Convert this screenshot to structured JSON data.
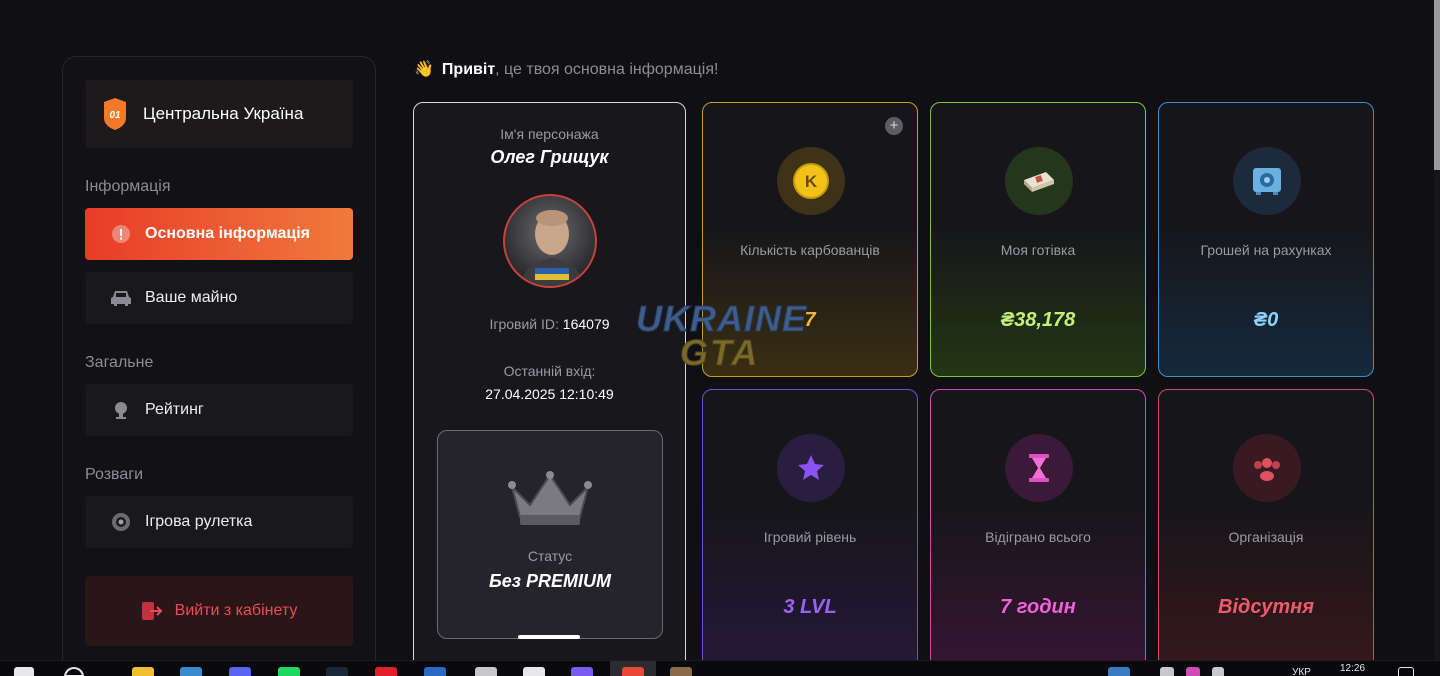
{
  "sidebar": {
    "server_badge": "01",
    "server_name": "Центральна Україна",
    "sections": {
      "info": "Інформація",
      "general": "Загальне",
      "fun": "Розваги"
    },
    "items": {
      "main_info": "Основна інформація",
      "property": "Ваше майно",
      "rating": "Рейтинг",
      "roulette": "Ігрова рулетка",
      "logout": "Вийти з кабінету"
    }
  },
  "greeting": {
    "wave": "👋",
    "hello": "Привіт",
    "rest": ", це твоя основна інформація!"
  },
  "character": {
    "name_label": "Ім'я персонажа",
    "name": "Олег Грищук",
    "id_label": "Ігровий ID:",
    "id": "164079",
    "last_login_label": "Останній вхід:",
    "last_login": "27.04.2025 12:10:49",
    "status_label": "Статус",
    "status": "Без PREMIUM"
  },
  "stats": {
    "karbovantsi": {
      "label": "Кількість карбованців",
      "value": "7",
      "icon": "coin-k-icon"
    },
    "cash": {
      "label": "Моя готівка",
      "value": "₴38,178",
      "icon": "money-stack-icon"
    },
    "bank": {
      "label": "Грошей на рахунках",
      "value": "₴0",
      "icon": "safe-icon"
    },
    "level": {
      "label": "Ігровий рівень",
      "value": "3 LVL",
      "icon": "star-icon"
    },
    "played": {
      "label": "Відіграно всього",
      "value": "7 годин",
      "icon": "hourglass-icon"
    },
    "organization": {
      "label": "Організація",
      "value": "Відсутня",
      "icon": "group-icon"
    }
  },
  "watermark": {
    "line1": "UKRAINE",
    "line2": "GTA"
  },
  "taskbar": {
    "lang": "УКР",
    "time": "12:26"
  }
}
